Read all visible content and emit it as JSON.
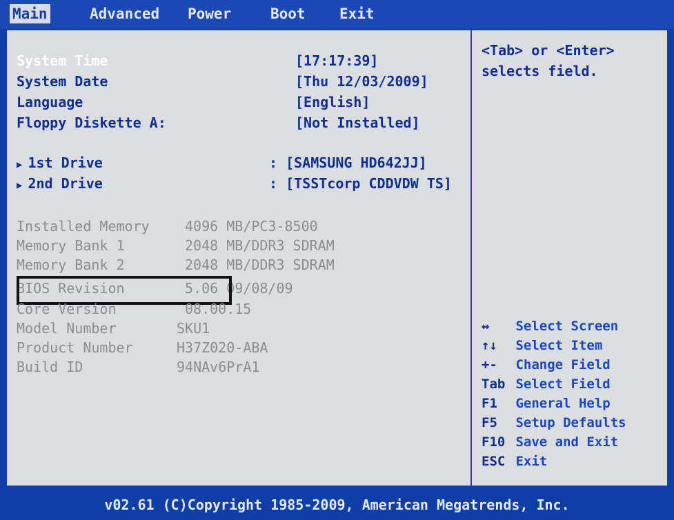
{
  "menu": {
    "tabs": [
      {
        "label": "Main"
      },
      {
        "label": "Advanced"
      },
      {
        "label": "Power"
      },
      {
        "label": "Boot"
      },
      {
        "label": "Exit"
      }
    ]
  },
  "main": {
    "items": [
      {
        "label": "System Time",
        "value": "[17:17:39]"
      },
      {
        "label": "System Date",
        "value": "[Thu 12/03/2009]"
      },
      {
        "label": "Language",
        "value": "[English]"
      },
      {
        "label": "Floppy Diskette A:",
        "value": "[Not Installed]"
      }
    ],
    "drives": [
      {
        "label": "1st Drive",
        "value": ": [SAMSUNG HD642JJ]"
      },
      {
        "label": "2nd Drive",
        "value": ": [TSSTcorp CDDVDW TS]"
      }
    ],
    "info": [
      {
        "label": "Installed Memory",
        "value": "4096 MB/PC3-8500"
      },
      {
        "label": "Memory Bank 1",
        "value": "2048 MB/DDR3 SDRAM"
      },
      {
        "label": "Memory Bank 2",
        "value": "2048 MB/DDR3 SDRAM"
      },
      {
        "label": "BIOS Revision",
        "value": "5.06 09/08/09"
      },
      {
        "label": "Core Version",
        "value": "08.00.15"
      },
      {
        "label": "Model Number",
        "value": "SKU1"
      },
      {
        "label": "Product Number",
        "value": "H37Z020-ABA"
      },
      {
        "label": "Build ID",
        "value": "94NAv6PrA1"
      }
    ]
  },
  "help": {
    "line1": "<Tab> or <Enter>",
    "line2": "selects field.",
    "keys": [
      {
        "key": "↔",
        "desc": "Select Screen"
      },
      {
        "key": "↑↓",
        "desc": "Select Item"
      },
      {
        "key": "+-",
        "desc": "Change Field"
      },
      {
        "key": "Tab",
        "desc": "Select Field"
      },
      {
        "key": "F1",
        "desc": "General Help"
      },
      {
        "key": "F5",
        "desc": "Setup Defaults"
      },
      {
        "key": "F10",
        "desc": "Save and Exit"
      },
      {
        "key": "ESC",
        "desc": "Exit"
      }
    ]
  },
  "footer": "v02.61 (C)Copyright 1985-2009, American Megatrends, Inc."
}
